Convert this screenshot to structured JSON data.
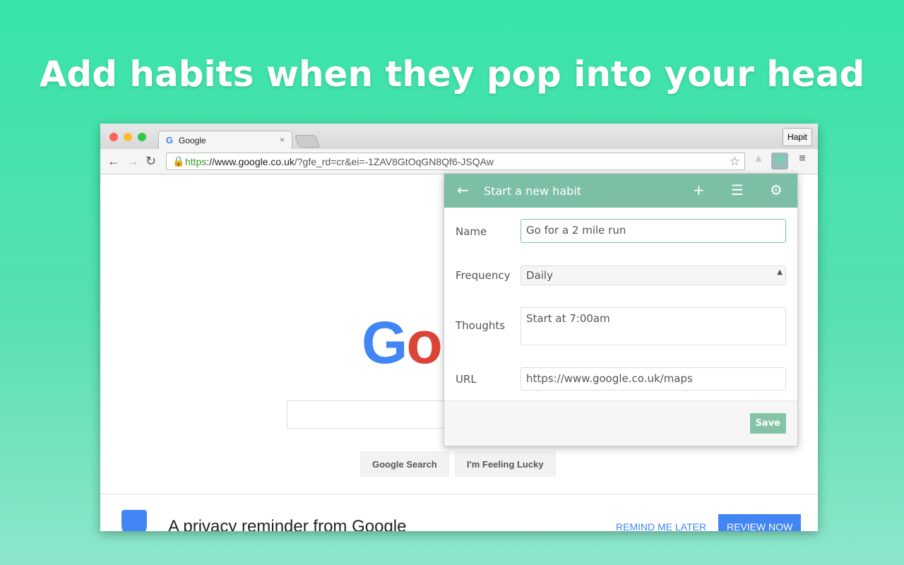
{
  "headline": "Add habits when they pop into your head",
  "browser": {
    "tab_title": "Google",
    "tab_favicon": "G",
    "extension_button": "Hapit",
    "url_scheme": "https",
    "url_host": "://www.google.co.uk",
    "url_path": "/?gfe_rd=cr&ei=-1ZAV8GtOqGN8Qf6-JSQAw"
  },
  "google": {
    "logo_partial": "Go",
    "search_button": "Google Search",
    "lucky_button": "I'm Feeling Lucky",
    "privacy_title": "A privacy reminder from Google",
    "remind_later": "REMIND ME LATER",
    "review_now": "REVIEW NOW"
  },
  "popup": {
    "title": "Start a new habit",
    "name_label": "Name",
    "name_value": "Go for a 2 mile run",
    "frequency_label": "Frequency",
    "frequency_value": "Daily",
    "thoughts_label": "Thoughts",
    "thoughts_value": "Start at 7:00am",
    "url_label": "URL",
    "url_value": "https://www.google.co.uk/maps",
    "save": "Save",
    "header_color": "#7dbfa5"
  }
}
